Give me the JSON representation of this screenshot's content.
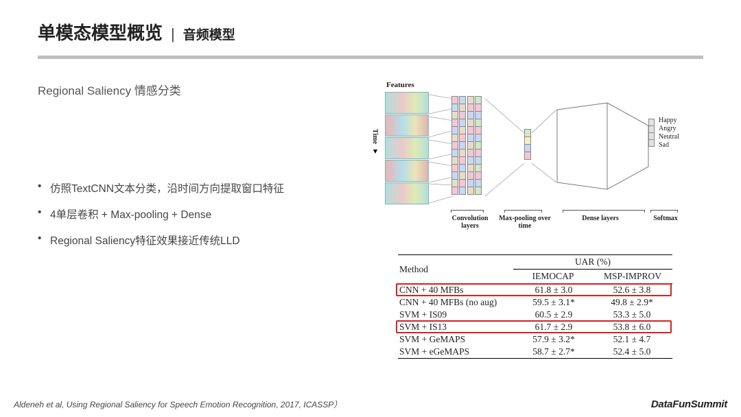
{
  "header": {
    "title_main": "单模态模型概览",
    "title_sep": "|",
    "title_sub": "音频模型"
  },
  "left": {
    "section_title": "Regional Saliency 情感分类",
    "bullets": [
      "仿照TextCNN文本分类，沿时间方向提取窗口特征",
      "4单层卷积 + Max-pooling + Dense",
      "Regional Saliency特征效果接近传统LLD"
    ]
  },
  "arch": {
    "features_label": "Features",
    "time_label": "Time",
    "sublabels": {
      "conv": "Convolution layers",
      "pool": "Max-pooling over time",
      "dense": "Dense layers",
      "softmax": "Softmax"
    },
    "emotions": [
      "Happy",
      "Angry",
      "Neutral",
      "Sad"
    ]
  },
  "chart_data": {
    "type": "table",
    "title": "UAR (%)",
    "columns": [
      "Method",
      "IEMOCAP",
      "MSP-IMPROV"
    ],
    "rows": [
      {
        "method": "CNN + 40 MFBs",
        "iemocap": "61.8 ± 3.0",
        "msp": "52.6 ± 3.8",
        "highlight": true
      },
      {
        "method": "CNN + 40 MFBs (no aug)",
        "iemocap": "59.5 ± 3.1*",
        "msp": "49.8 ± 2.9*",
        "highlight": false
      },
      {
        "method": "SVM + IS09",
        "iemocap": "60.5 ± 2.9",
        "msp": "53.3 ± 5.0",
        "highlight": false
      },
      {
        "method": "SVM + IS13",
        "iemocap": "61.7 ± 2.9",
        "msp": "53.8 ± 6.0",
        "highlight": true
      },
      {
        "method": "SVM + GeMAPS",
        "iemocap": "57.9 ± 3.2*",
        "msp": "52.1 ± 4.7",
        "highlight": false
      },
      {
        "method": "SVM + eGeMAPS",
        "iemocap": "58.7 ± 2.7*",
        "msp": "52.4 ± 5.0",
        "highlight": false
      }
    ]
  },
  "footer": {
    "citation": "Aldeneh et al, Using Regional Saliency for Speech Emotion Recognition, 2017, ICASSP）",
    "brand": "DataFunSummit"
  }
}
